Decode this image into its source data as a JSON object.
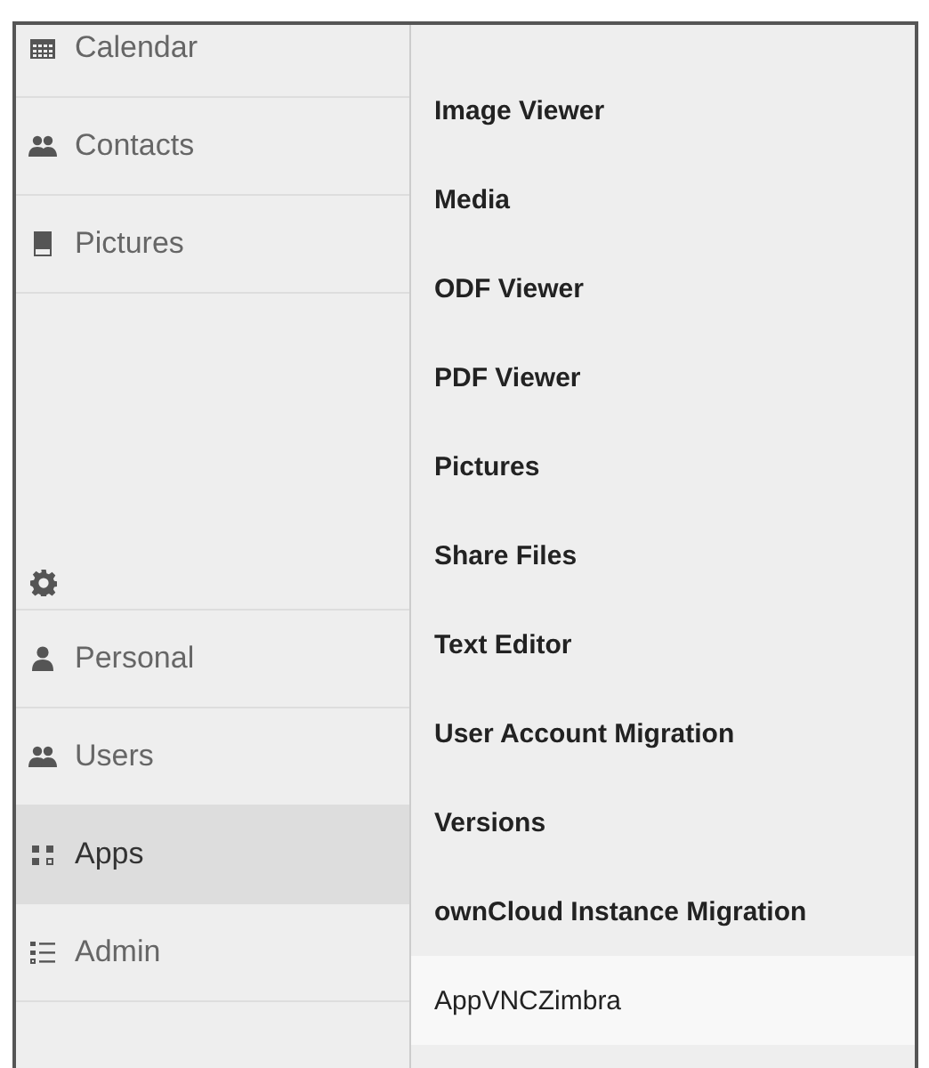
{
  "navigation": {
    "items": [
      {
        "label": "Calendar",
        "selected": false
      },
      {
        "label": "Contacts",
        "selected": false
      },
      {
        "label": "Pictures",
        "selected": false
      }
    ]
  },
  "settings": {
    "items": [
      {
        "label": "Personal",
        "selected": false
      },
      {
        "label": "Users",
        "selected": false
      },
      {
        "label": "Apps",
        "selected": true
      },
      {
        "label": "Admin",
        "selected": false
      }
    ]
  },
  "apps": [
    {
      "name": "Image Viewer",
      "enabled": true
    },
    {
      "name": "Media",
      "enabled": true
    },
    {
      "name": "ODF Viewer",
      "enabled": true
    },
    {
      "name": "PDF Viewer",
      "enabled": true
    },
    {
      "name": "Pictures",
      "enabled": true
    },
    {
      "name": "Share Files",
      "enabled": true
    },
    {
      "name": "Text Editor",
      "enabled": true
    },
    {
      "name": "User Account Migration",
      "enabled": true
    },
    {
      "name": "Versions",
      "enabled": true
    },
    {
      "name": "ownCloud Instance Migration",
      "enabled": true
    },
    {
      "name": "AppVNCZimbra",
      "enabled": false
    }
  ]
}
